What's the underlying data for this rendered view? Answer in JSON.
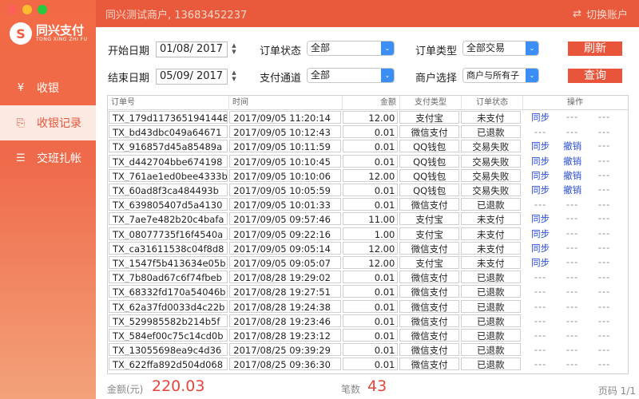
{
  "brand": {
    "name_cn": "同兴支付",
    "name_en": "TONG XING ZHI FU",
    "logo_glyph": "S"
  },
  "sidebar": {
    "items": [
      {
        "label": "收银",
        "icon": "yen-icon",
        "glyph": "¥",
        "active": false
      },
      {
        "label": "收银记录",
        "icon": "receipt-icon",
        "glyph": "⎘",
        "active": true
      },
      {
        "label": "交班扎帐",
        "icon": "document-icon",
        "glyph": "☰",
        "active": false
      }
    ]
  },
  "header": {
    "merchant": "同兴测试商户, 13683452237",
    "switch_label": "切换账户",
    "switch_glyph": "⇄"
  },
  "filters": {
    "start_label": "开始日期",
    "start_date": "01/08/ 2017",
    "end_label": "结束日期",
    "end_date": "05/09/ 2017",
    "status_label": "订单状态",
    "status_value": "全部",
    "channel_label": "支付通道",
    "channel_value": "全部",
    "type_label": "订单类型",
    "type_value": "全部交易",
    "merchant_label": "商户选择",
    "merchant_value": "商户与所有子",
    "refresh_label": "刷新",
    "query_label": "查询"
  },
  "table": {
    "headers": [
      "订单号",
      "时间",
      "金额",
      "支付类型",
      "订单状态",
      "操作"
    ],
    "rows": [
      {
        "id": "TX_179d1173651941448",
        "time": "2017/09/05 11:20:14",
        "amount": "12.00",
        "type": "支付宝",
        "status": "未支付",
        "op1": "同步",
        "op2": "---",
        "op3": "---"
      },
      {
        "id": "TX_bd43dbc049a64671",
        "time": "2017/09/05 10:12:43",
        "amount": "0.01",
        "type": "微信支付",
        "status": "已退款",
        "op1": "---",
        "op2": "---",
        "op3": "---"
      },
      {
        "id": "TX_916857d45a85489a",
        "time": "2017/09/05 10:11:59",
        "amount": "0.01",
        "type": "QQ钱包",
        "status": "交易失败",
        "op1": "同步",
        "op2": "撤销",
        "op3": "---"
      },
      {
        "id": "TX_d442704bbe674198",
        "time": "2017/09/05 10:10:45",
        "amount": "0.01",
        "type": "QQ钱包",
        "status": "交易失败",
        "op1": "同步",
        "op2": "撤销",
        "op3": "---"
      },
      {
        "id": "TX_761ae1ed0bee4333b",
        "time": "2017/09/05 10:10:06",
        "amount": "12.00",
        "type": "QQ钱包",
        "status": "交易失败",
        "op1": "同步",
        "op2": "撤销",
        "op3": "---"
      },
      {
        "id": "TX_60ad8f3ca484493b",
        "time": "2017/09/05 10:05:59",
        "amount": "0.01",
        "type": "QQ钱包",
        "status": "交易失败",
        "op1": "同步",
        "op2": "撤销",
        "op3": "---"
      },
      {
        "id": "TX_639805407d5a4130",
        "time": "2017/09/05 10:01:33",
        "amount": "0.01",
        "type": "微信支付",
        "status": "已退款",
        "op1": "---",
        "op2": "---",
        "op3": "---"
      },
      {
        "id": "TX_7ae7e482b20c4bafa",
        "time": "2017/09/05 09:57:46",
        "amount": "11.00",
        "type": "支付宝",
        "status": "未支付",
        "op1": "同步",
        "op2": "---",
        "op3": "---"
      },
      {
        "id": "TX_08077735f16f4540a",
        "time": "2017/09/05 09:22:16",
        "amount": "1.00",
        "type": "支付宝",
        "status": "未支付",
        "op1": "同步",
        "op2": "---",
        "op3": "---"
      },
      {
        "id": "TX_ca31611538c04f8d8",
        "time": "2017/09/05 09:05:14",
        "amount": "12.00",
        "type": "微信支付",
        "status": "未支付",
        "op1": "同步",
        "op2": "---",
        "op3": "---"
      },
      {
        "id": "TX_1547f5b413634e05b",
        "time": "2017/09/05 09:05:07",
        "amount": "12.00",
        "type": "支付宝",
        "status": "未支付",
        "op1": "同步",
        "op2": "---",
        "op3": "---"
      },
      {
        "id": "TX_7b80ad67c6f74fbeb",
        "time": "2017/08/28 19:29:02",
        "amount": "0.01",
        "type": "微信支付",
        "status": "已退款",
        "op1": "---",
        "op2": "---",
        "op3": "---"
      },
      {
        "id": "TX_68332fd170a54046b",
        "time": "2017/08/28 19:27:51",
        "amount": "0.01",
        "type": "微信支付",
        "status": "已退款",
        "op1": "---",
        "op2": "---",
        "op3": "---"
      },
      {
        "id": "TX_62a37fd0033d4c22b",
        "time": "2017/08/28 19:24:38",
        "amount": "0.01",
        "type": "微信支付",
        "status": "已退款",
        "op1": "---",
        "op2": "---",
        "op3": "---"
      },
      {
        "id": "TX_529985582b214b5f",
        "time": "2017/08/28 19:23:46",
        "amount": "0.01",
        "type": "微信支付",
        "status": "已退款",
        "op1": "---",
        "op2": "---",
        "op3": "---"
      },
      {
        "id": "TX_584ef00c75c14cd0b",
        "time": "2017/08/28 19:23:12",
        "amount": "0.01",
        "type": "微信支付",
        "status": "已退款",
        "op1": "---",
        "op2": "---",
        "op3": "---"
      },
      {
        "id": "TX_13055698ea9c4d36",
        "time": "2017/08/25 09:39:29",
        "amount": "0.01",
        "type": "微信支付",
        "status": "已退款",
        "op1": "---",
        "op2": "---",
        "op3": "---"
      },
      {
        "id": "TX_622ffa892d504d068",
        "time": "2017/08/25 09:36:30",
        "amount": "0.01",
        "type": "微信支付",
        "status": "已退款",
        "op1": "---",
        "op2": "---",
        "op3": "---"
      }
    ]
  },
  "footer": {
    "amount_label": "金额(元)",
    "amount_value": "220.03",
    "count_label": "笔数",
    "count_value": "43",
    "page_label": "页码 1/1"
  },
  "colors": {
    "accent": "#e9553b",
    "link": "#2a4fd8"
  }
}
